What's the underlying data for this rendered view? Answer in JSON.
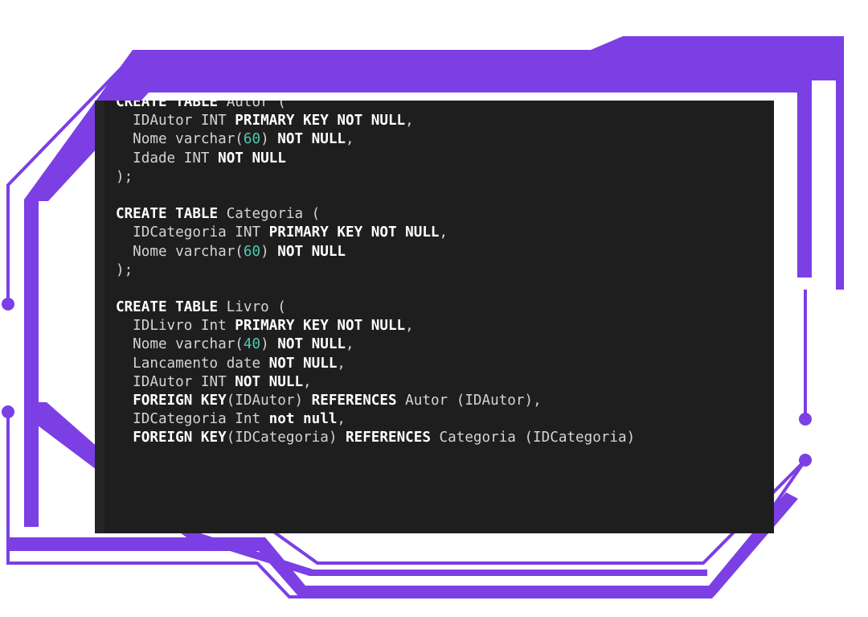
{
  "editor": {
    "language": "sql",
    "colors": {
      "background": "#1e1e1e",
      "text": "#d4d4d4",
      "keyword": "#ffffff",
      "number": "#4ec9b0",
      "frame_accent": "#7b3fe4"
    },
    "lines": [
      [
        {
          "t": "CREATE TABLE",
          "c": "kw"
        },
        {
          "t": " Autor (",
          "c": "id"
        }
      ],
      [
        {
          "t": "  IDAutor INT ",
          "c": "id"
        },
        {
          "t": "PRIMARY KEY NOT NULL",
          "c": "kw"
        },
        {
          "t": ",",
          "c": "id"
        }
      ],
      [
        {
          "t": "  Nome varchar(",
          "c": "id"
        },
        {
          "t": "60",
          "c": "num"
        },
        {
          "t": ") ",
          "c": "id"
        },
        {
          "t": "NOT NULL",
          "c": "kw"
        },
        {
          "t": ",",
          "c": "id"
        }
      ],
      [
        {
          "t": "  Idade INT ",
          "c": "id"
        },
        {
          "t": "NOT NULL",
          "c": "kw"
        }
      ],
      [
        {
          "t": ");",
          "c": "id"
        }
      ],
      [
        {
          "t": "",
          "c": "id"
        }
      ],
      [
        {
          "t": "CREATE TABLE",
          "c": "kw"
        },
        {
          "t": " Categoria (",
          "c": "id"
        }
      ],
      [
        {
          "t": "  IDCategoria INT ",
          "c": "id"
        },
        {
          "t": "PRIMARY KEY NOT NULL",
          "c": "kw"
        },
        {
          "t": ",",
          "c": "id"
        }
      ],
      [
        {
          "t": "  Nome varchar(",
          "c": "id"
        },
        {
          "t": "60",
          "c": "num"
        },
        {
          "t": ") ",
          "c": "id"
        },
        {
          "t": "NOT NULL",
          "c": "kw"
        }
      ],
      [
        {
          "t": ");",
          "c": "id"
        }
      ],
      [
        {
          "t": "",
          "c": "id"
        }
      ],
      [
        {
          "t": "CREATE TABLE",
          "c": "kw"
        },
        {
          "t": " Livro (",
          "c": "id"
        }
      ],
      [
        {
          "t": "  IDLivro Int ",
          "c": "id"
        },
        {
          "t": "PRIMARY KEY NOT NULL",
          "c": "kw"
        },
        {
          "t": ",",
          "c": "id"
        }
      ],
      [
        {
          "t": "  Nome varchar(",
          "c": "id"
        },
        {
          "t": "40",
          "c": "num"
        },
        {
          "t": ") ",
          "c": "id"
        },
        {
          "t": "NOT NULL",
          "c": "kw"
        },
        {
          "t": ",",
          "c": "id"
        }
      ],
      [
        {
          "t": "  Lancamento date ",
          "c": "id"
        },
        {
          "t": "NOT NULL",
          "c": "kw"
        },
        {
          "t": ",",
          "c": "id"
        }
      ],
      [
        {
          "t": "  IDAutor INT ",
          "c": "id"
        },
        {
          "t": "NOT NULL",
          "c": "kw"
        },
        {
          "t": ",",
          "c": "id"
        }
      ],
      [
        {
          "t": "  ",
          "c": "id"
        },
        {
          "t": "FOREIGN KEY",
          "c": "kw"
        },
        {
          "t": "(IDAutor) ",
          "c": "id"
        },
        {
          "t": "REFERENCES",
          "c": "kw"
        },
        {
          "t": " Autor (IDAutor),",
          "c": "id"
        }
      ],
      [
        {
          "t": "  IDCategoria Int ",
          "c": "id"
        },
        {
          "t": "not null",
          "c": "kw"
        },
        {
          "t": ",",
          "c": "id"
        }
      ],
      [
        {
          "t": "  ",
          "c": "id"
        },
        {
          "t": "FOREIGN KEY",
          "c": "kw"
        },
        {
          "t": "(IDCategoria) ",
          "c": "id"
        },
        {
          "t": "REFERENCES",
          "c": "kw"
        },
        {
          "t": " Categoria (IDCategoria)",
          "c": "id"
        }
      ]
    ]
  }
}
